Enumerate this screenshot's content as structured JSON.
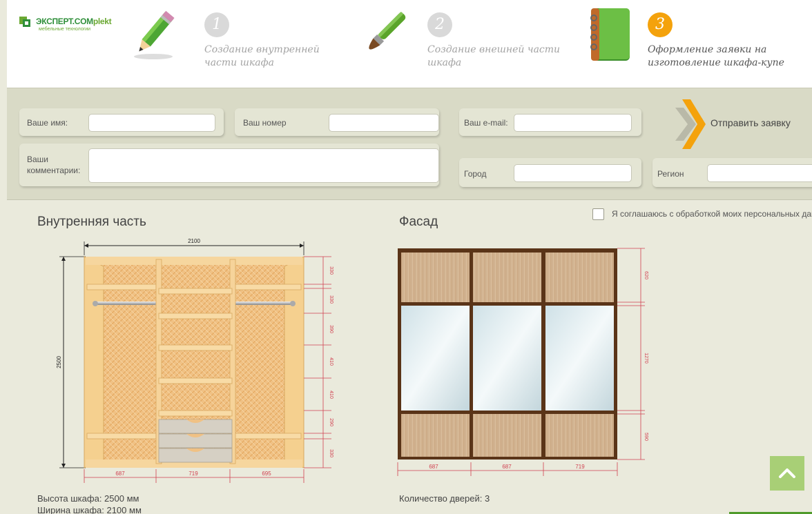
{
  "brand": {
    "name_main": "ЭКСПЕРТ.COM",
    "name_accent": "plekt",
    "tagline": "мебельные технологии"
  },
  "steps": [
    {
      "number": "1",
      "line1": "Создание внутренней",
      "line2": "части шкафа",
      "icon": "pencil-icon",
      "state": "done"
    },
    {
      "number": "2",
      "line1": "Создание внешней части",
      "line2": "шкафа",
      "icon": "brush-icon",
      "state": "done"
    },
    {
      "number": "3",
      "line1": "Оформление заявки на",
      "line2": "изготовление шкафа-купе",
      "icon": "notebook-icon",
      "state": "active"
    }
  ],
  "form": {
    "name_label": "Ваше имя:",
    "name_value": "",
    "phone_label": "Ваш номер",
    "phone_value": "",
    "email_label": "Ваш e-mail:",
    "email_value": "",
    "comments_label_1": "Ваши",
    "comments_label_2": "комментарии:",
    "comments_value": "",
    "city_label": "Город",
    "city_value": "",
    "region_label": "Регион",
    "region_value": "",
    "send_label": "Отправить заявку",
    "consent_label": "Я соглашаюсь с обработкой моих персональных данных",
    "consent_checked": false
  },
  "interior": {
    "title": "Внутренняя часть",
    "total_width": "2100",
    "total_height": "2500",
    "section_widths": [
      "687",
      "719",
      "695"
    ],
    "shelf_heights": [
      "330",
      "330",
      "390",
      "410",
      "410",
      "290",
      "330"
    ],
    "height_label": "Высота шкафа: 2500 мм",
    "width_label": "Ширина шкафа: 2100 мм"
  },
  "facade": {
    "title": "Фасад",
    "door_widths": [
      "687",
      "687",
      "719"
    ],
    "row_heights": [
      "620",
      "1270",
      "590"
    ],
    "doors_count_label": "Количество дверей: 3"
  },
  "colors": {
    "accent_orange": "#f4a20c",
    "brand_green": "#6aa832",
    "wood": "#f2c98b",
    "frame": "#5a3418"
  }
}
